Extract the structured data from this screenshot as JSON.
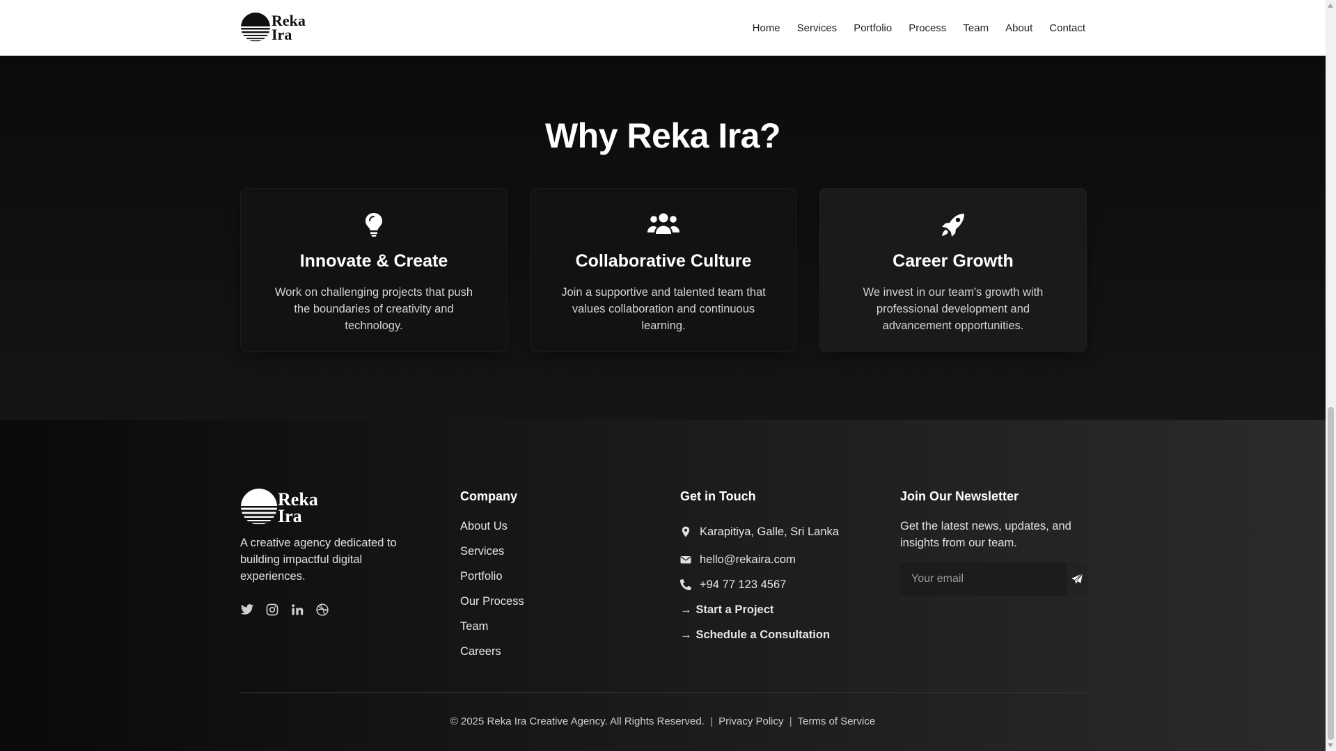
{
  "header": {
    "logo_text": [
      "Reka",
      "Ira"
    ],
    "nav": [
      "Home",
      "Services",
      "Portfolio",
      "Process",
      "Team",
      "About",
      "Contact"
    ]
  },
  "why": {
    "title": "Why Reka Ira?",
    "cards": [
      {
        "icon": "lightbulb-icon",
        "title": "Innovate & Create",
        "text": "Work on challenging projects that push the boundaries of creativity and technology."
      },
      {
        "icon": "users-icon",
        "title": "Collaborative Culture",
        "text": "Join a supportive and talented team that values collaboration and continuous learning."
      },
      {
        "icon": "rocket-icon",
        "title": "Career Growth",
        "text": "We invest in our team's growth with professional development and advancement opportunities."
      }
    ]
  },
  "footer": {
    "brand_text": "A creative agency dedicated to building impactful digital experiences.",
    "social": [
      "twitter-icon",
      "instagram-icon",
      "linkedin-icon",
      "dribbble-icon"
    ],
    "company": {
      "heading": "Company",
      "links": [
        "About Us",
        "Services",
        "Portfolio",
        "Our Process",
        "Team",
        "Careers"
      ]
    },
    "contact": {
      "heading": "Get in Touch",
      "address": "Karapitiya, Galle, Sri Lanka",
      "email": "hello@rekaira.com",
      "phone": "+94 77 123 4567",
      "cta_project": "Start a Project",
      "cta_consult": "Schedule a Consultation"
    },
    "newsletter": {
      "heading": "Join Our Newsletter",
      "text": "Get the latest news, updates, and insights from our team.",
      "placeholder": "Your email"
    },
    "bottom": {
      "copyright": "© 2025 Reka Ira Creative Agency. All Rights Reserved.",
      "privacy": "Privacy Policy",
      "terms": "Terms of Service",
      "separator": "|"
    }
  },
  "colors": {
    "header_bg": "#ffffff",
    "section_bg": "#0b0b0b",
    "text": "#ffffff"
  }
}
